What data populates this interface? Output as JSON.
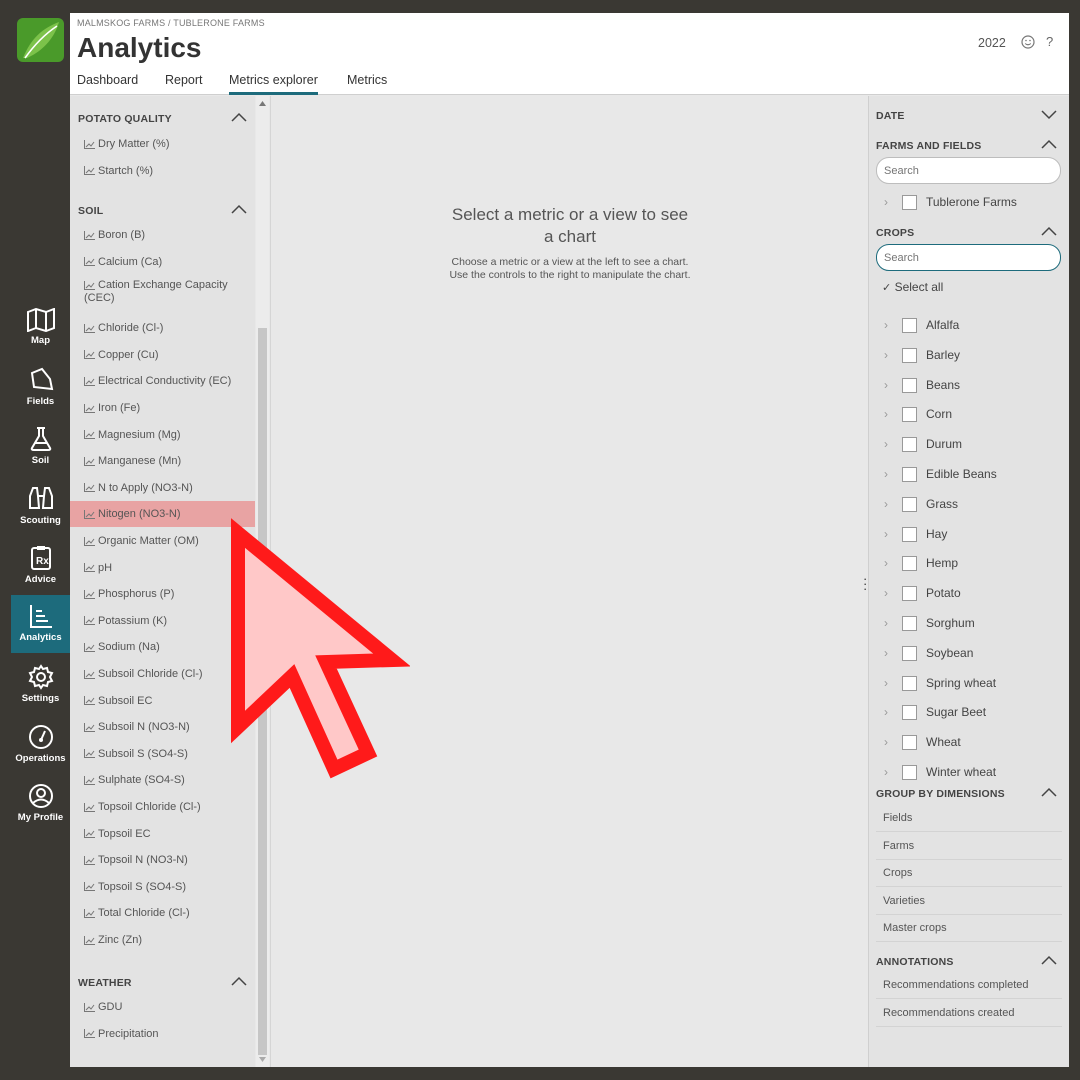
{
  "nav": {
    "items": [
      {
        "label": "Map",
        "icon": "map-icon"
      },
      {
        "label": "Fields",
        "icon": "field-icon"
      },
      {
        "label": "Soil",
        "icon": "flask-icon"
      },
      {
        "label": "Scouting",
        "icon": "binoculars-icon"
      },
      {
        "label": "Advice",
        "icon": "rx-icon"
      },
      {
        "label": "Analytics",
        "icon": "chart-icon",
        "active": true
      },
      {
        "label": "Settings",
        "icon": "gear-icon"
      },
      {
        "label": "Operations",
        "icon": "gauge-icon"
      },
      {
        "label": "My Profile",
        "icon": "profile-icon"
      }
    ]
  },
  "header": {
    "breadcrumb": "MALMSKOG FARMS / TUBLERONE FARMS",
    "title": "Analytics",
    "year": "2022",
    "help": "?"
  },
  "tabs": [
    {
      "label": "Dashboard"
    },
    {
      "label": "Report"
    },
    {
      "label": "Metrics explorer",
      "active": true
    },
    {
      "label": "Metrics"
    }
  ],
  "metrics": {
    "potato_quality": {
      "title": "POTATO QUALITY",
      "items": [
        "Dry Matter (%)",
        "Startch (%)"
      ]
    },
    "soil": {
      "title": "SOIL",
      "items": [
        "Boron (B)",
        "Calcium (Ca)",
        "Cation Exchange Capacity (CEC)",
        "Chloride (Cl-)",
        "Copper (Cu)",
        "Electrical Conductivity (EC)",
        "Iron (Fe)",
        "Magnesium (Mg)",
        "Manganese (Mn)",
        "N to Apply (NO3-N)",
        "Nitogen (NO3-N)",
        "Organic Matter (OM)",
        "pH",
        "Phosphorus (P)",
        "Potassium (K)",
        "Sodium (Na)",
        "Subsoil Chloride (Cl-)",
        "Subsoil EC",
        "Subsoil N (NO3-N)",
        "Subsoil S (SO4-S)",
        "Sulphate (SO4-S)",
        "Topsoil Chloride (Cl-)",
        "Topsoil EC",
        "Topsoil N (NO3-N)",
        "Topsoil S (SO4-S)",
        "Total Chloride (Cl-)",
        "Zinc (Zn)"
      ],
      "selected": "Nitogen (NO3-N)"
    },
    "weather": {
      "title": "WEATHER",
      "items": [
        "GDU",
        "Precipitation"
      ]
    }
  },
  "center": {
    "heading": "Select a metric or a view to see a chart",
    "text": "Choose a metric or a view at the left to see a chart. Use the controls to the right to manipulate the chart."
  },
  "filters": {
    "date": {
      "title": "DATE"
    },
    "farms": {
      "title": "FARMS AND FIELDS",
      "placeholder": "Search",
      "items": [
        "Tublerone Farms"
      ]
    },
    "crops": {
      "title": "CROPS",
      "placeholder": "Search",
      "select_all": "Select all",
      "items": [
        "Alfalfa",
        "Barley",
        "Beans",
        "Corn",
        "Durum",
        "Edible Beans",
        "Grass",
        "Hay",
        "Hemp",
        "Potato",
        "Sorghum",
        "Soybean",
        "Spring wheat",
        "Sugar Beet",
        "Wheat",
        "Winter wheat"
      ]
    },
    "group": {
      "title": "GROUP BY DIMENSIONS",
      "items": [
        "Fields",
        "Farms",
        "Crops",
        "Varieties",
        "Master crops"
      ]
    },
    "annotations": {
      "title": "ANNOTATIONS",
      "items": [
        "Recommendations completed",
        "Recommendations created"
      ]
    }
  },
  "colors": {
    "accent": "#1d6b7c",
    "selected_row": "#e8a3a3",
    "pointer_fill": "#ffc8c8",
    "pointer_stroke": "#ff1a1a",
    "logo": "#4a9a2a"
  }
}
